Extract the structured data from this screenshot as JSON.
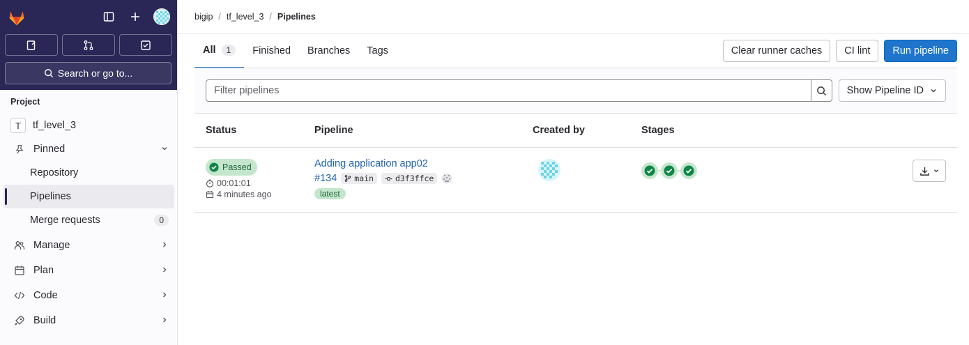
{
  "sidebar": {
    "search_label": "Search or go to...",
    "section_label": "Project",
    "project": {
      "initial": "T",
      "name": "tf_level_3"
    },
    "pinned_label": "Pinned",
    "pinned_items": [
      {
        "label": "Repository"
      },
      {
        "label": "Pipelines",
        "active": true
      },
      {
        "label": "Merge requests",
        "count": "0"
      }
    ],
    "groups": [
      {
        "label": "Manage",
        "icon": "users-icon"
      },
      {
        "label": "Plan",
        "icon": "calendar-icon"
      },
      {
        "label": "Code",
        "icon": "code-icon"
      },
      {
        "label": "Build",
        "icon": "rocket-icon"
      }
    ]
  },
  "breadcrumb": {
    "items": [
      "bigip",
      "tf_level_3",
      "Pipelines"
    ]
  },
  "tabs": [
    {
      "label": "All",
      "count": "1",
      "active": true
    },
    {
      "label": "Finished"
    },
    {
      "label": "Branches"
    },
    {
      "label": "Tags"
    }
  ],
  "actions": {
    "clear_caches": "Clear runner caches",
    "ci_lint": "CI lint",
    "run_pipeline": "Run pipeline"
  },
  "filter": {
    "placeholder": "Filter pipelines",
    "show_id": "Show Pipeline ID"
  },
  "table": {
    "headers": {
      "status": "Status",
      "pipeline": "Pipeline",
      "created_by": "Created by",
      "stages": "Stages"
    },
    "rows": [
      {
        "status": "Passed",
        "duration": "00:01:01",
        "finished": "4 minutes ago",
        "title": "Adding application app02",
        "id": "#134",
        "branch": "main",
        "commit": "d3f3ffce",
        "tag": "latest",
        "stages": [
          "passed",
          "passed",
          "passed"
        ]
      }
    ]
  },
  "colors": {
    "brand_dark": "#2a2756",
    "primary": "#1f75cb",
    "success_bg": "#c3e6cd",
    "success": "#108548"
  }
}
